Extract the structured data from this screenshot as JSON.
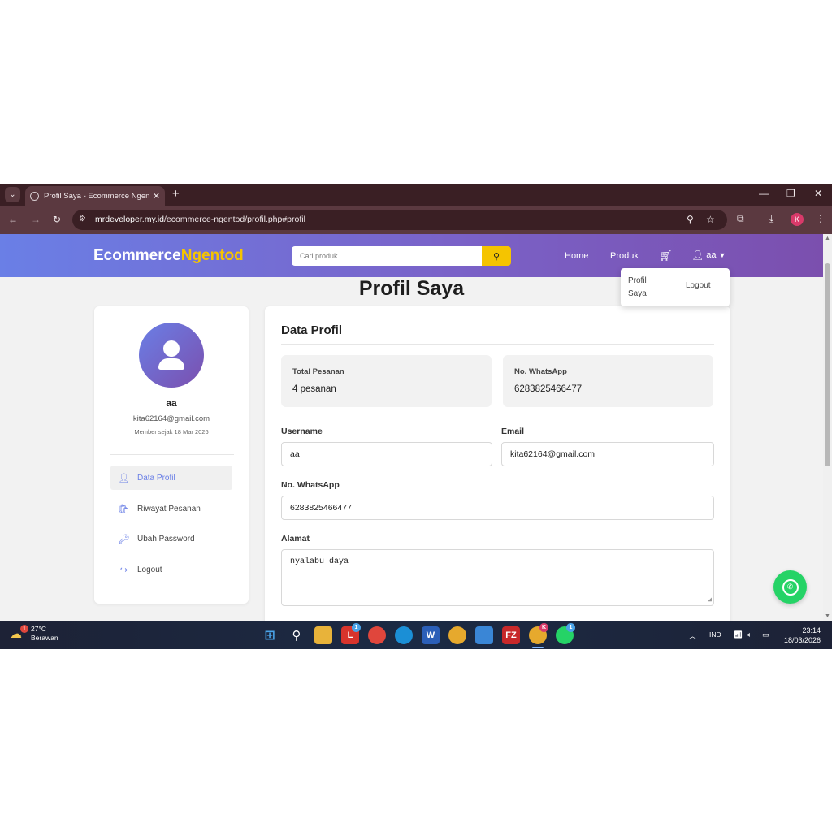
{
  "browser": {
    "tab_title": "Profil Saya - Ecommerce Ngentod",
    "url_domain": "mrdeveloper.my.id",
    "url_path": "/ecommerce-ngentod/profil.php#profil",
    "profile_initial": "K"
  },
  "site": {
    "brand_part1": "Ecommerce",
    "brand_part2": "Ngentod",
    "search_placeholder": "Cari produk...",
    "nav_home": "Home",
    "nav_produk": "Produk",
    "user_name": "aa",
    "dropdown": {
      "profil": "Profil Saya",
      "logout": "Logout"
    }
  },
  "page_title": "Profil Saya",
  "left_panel": {
    "name": "aa",
    "email": "kita62164@gmail.com",
    "member_since": "Member sejak 18 Mar 2026",
    "menu": [
      {
        "label": "Data Profil",
        "icon": "user-icon",
        "active": true
      },
      {
        "label": "Riwayat Pesanan",
        "icon": "shopping-bag-icon",
        "active": false
      },
      {
        "label": "Ubah Password",
        "icon": "key-icon",
        "active": false
      },
      {
        "label": "Logout",
        "icon": "logout-icon",
        "active": false
      }
    ]
  },
  "profile": {
    "heading": "Data Profil",
    "stats": [
      {
        "label": "Total Pesanan",
        "value": "4 pesanan"
      },
      {
        "label": "No. WhatsApp",
        "value": "6283825466477"
      }
    ],
    "fields": {
      "username_label": "Username",
      "username_value": "aa",
      "email_label": "Email",
      "email_value": "kita62164@gmail.com",
      "whatsapp_label": "No. WhatsApp",
      "whatsapp_value": "6283825466477",
      "alamat_label": "Alamat",
      "alamat_value": "nyalabu daya"
    }
  },
  "taskbar": {
    "weather_temp": "27°C",
    "weather_desc": "Berawan",
    "weather_badge": "1",
    "language": "IND",
    "time": "23:14",
    "date": "18/03/2026"
  },
  "colors": {
    "nav_gradient_start": "#6a7fe6",
    "nav_gradient_end": "#7b4fae",
    "brand_accent": "#f5c400",
    "whatsapp_green": "#25d366"
  }
}
